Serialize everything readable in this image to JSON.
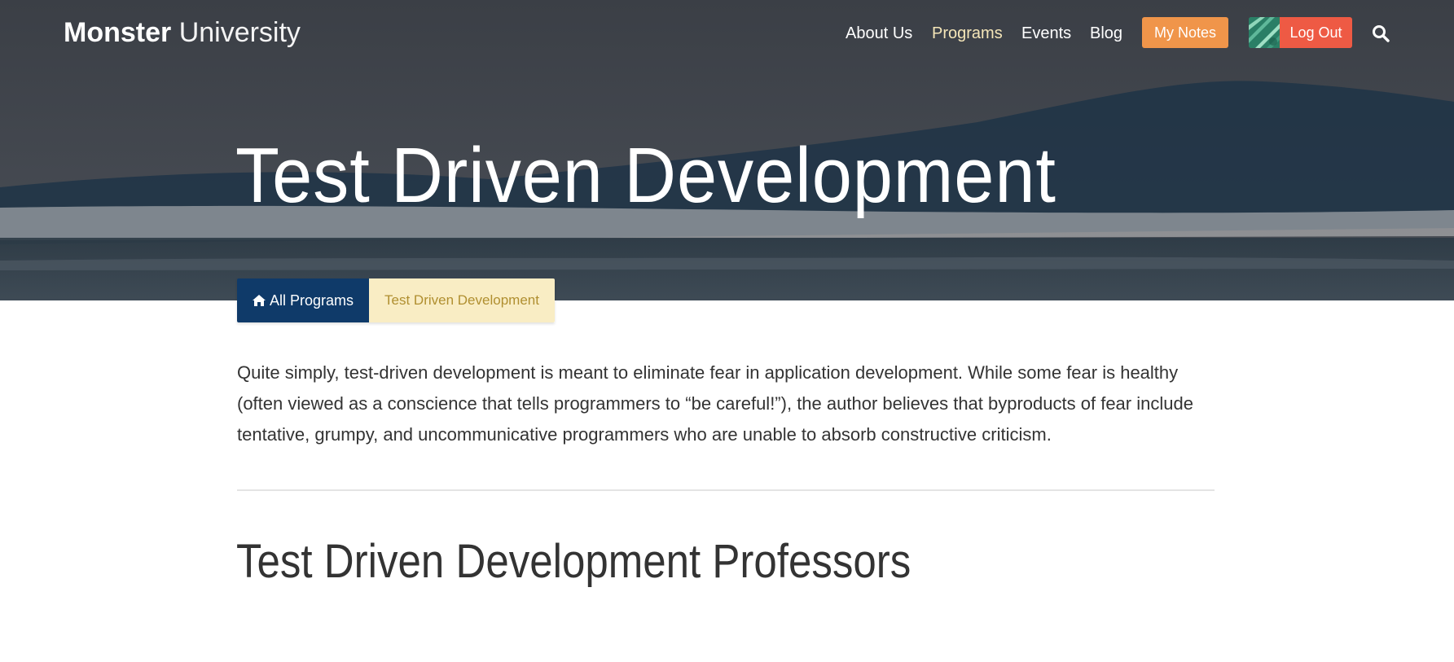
{
  "header": {
    "logo_strong": "Monster",
    "logo_light": "University",
    "nav": [
      {
        "label": "About Us",
        "active": false
      },
      {
        "label": "Programs",
        "active": true
      },
      {
        "label": "Events",
        "active": false
      },
      {
        "label": "Blog",
        "active": false
      }
    ],
    "my_notes_label": "My Notes",
    "logout_label": "Log Out",
    "search_icon": "search-icon",
    "avatar_icon": "avatar"
  },
  "hero": {
    "title": "Test Driven Development"
  },
  "breadcrumb": {
    "home_icon": "home-icon",
    "home_label": "All Programs",
    "current_label": "Test Driven Development"
  },
  "content": {
    "intro": "Quite simply, test-driven development is meant to eliminate fear in application development. While some fear is healthy (often viewed as a conscience that tells programmers to “be careful!”), the author believes that byproducts of fear include tentative, grumpy, and uncommunicative programmers who are unable to absorb constructive criticism.",
    "professors_heading": "Test Driven Development Professors"
  },
  "colors": {
    "brand_navy": "#0f3a69",
    "my_notes_orange": "#f0954a",
    "logout_red": "#ee5a44",
    "breadcrumb_current_bg": "#f9edc4",
    "breadcrumb_current_text": "#b08f30",
    "nav_active": "#f5e6b8"
  }
}
